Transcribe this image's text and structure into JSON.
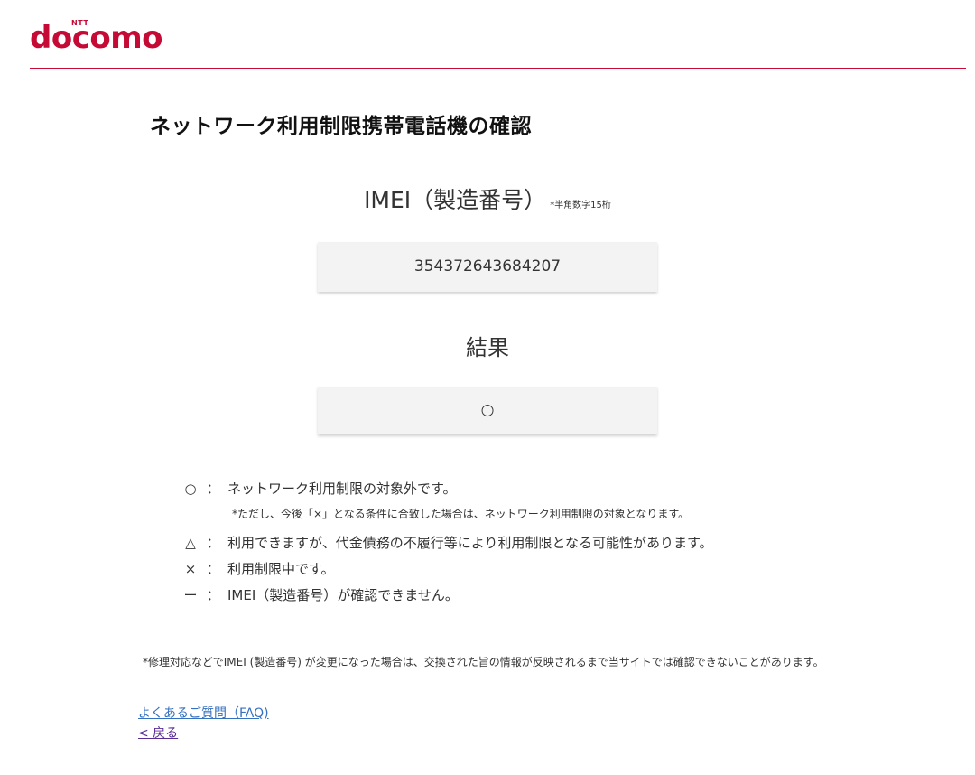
{
  "header": {
    "logo_brand": "docomo",
    "logo_ntt": "NTT",
    "brand_color": "#c40a35"
  },
  "page": {
    "title": "ネットワーク利用制限携帯電話機の確認"
  },
  "imei": {
    "label": "IMEI（製造番号）",
    "note": "*半角数字15桁",
    "value": "354372643684207"
  },
  "result": {
    "label": "結果",
    "value": "○"
  },
  "legend": {
    "items": [
      {
        "symbol": "○",
        "colon": "：",
        "text": "ネットワーク利用制限の対象外です。"
      },
      {
        "symbol": "△",
        "colon": "：",
        "text": "利用できますが、代金債務の不履行等により利用制限となる可能性があります。"
      },
      {
        "symbol": "×",
        "colon": "：",
        "text": "利用制限中です。"
      },
      {
        "symbol": "ー",
        "colon": "：",
        "text": "IMEI（製造番号）が確認できません。"
      }
    ],
    "sub_note": "*ただし、今後「×」となる条件に合致した場合は、ネットワーク利用制限の対象となります。"
  },
  "footnote": "*修理対応などでIMEI (製造番号) が変更になった場合は、交換された旨の情報が反映されるまで当サイトでは確認できないことがあります。",
  "links": {
    "faq": "よくあるご質問（FAQ)",
    "back": "< 戻る"
  }
}
